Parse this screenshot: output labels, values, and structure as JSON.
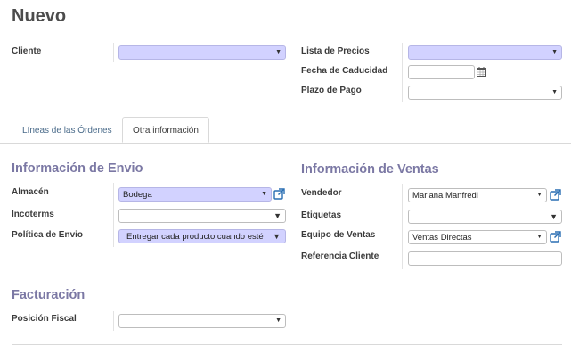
{
  "header": {
    "title": "Nuevo"
  },
  "top_left": {
    "client_label": "Cliente",
    "client_value": ""
  },
  "top_right": {
    "pricelist_label": "Lista de Precios",
    "pricelist_value": "",
    "expiration_label": "Fecha de Caducidad",
    "expiration_value": "",
    "payment_label": "Plazo de Pago",
    "payment_value": ""
  },
  "tabs": [
    {
      "label": "Líneas de las Órdenes",
      "active": false
    },
    {
      "label": "Otra información",
      "active": true
    }
  ],
  "shipping": {
    "title": "Información de Envio",
    "warehouse_label": "Almacén",
    "warehouse_value": "Bodega",
    "incoterms_label": "Incoterms",
    "incoterms_value": "",
    "policy_label": "Política de Envio",
    "policy_value": "Entregar cada producto cuando esté"
  },
  "sales": {
    "title": "Información de Ventas",
    "salesperson_label": "Vendedor",
    "salesperson_value": "Mariana Manfredi",
    "tags_label": "Etiquetas",
    "tags_value": "",
    "team_label": "Equipo de Ventas",
    "team_value": "Ventas Directas",
    "reference_label": "Referencia Cliente",
    "reference_value": ""
  },
  "billing": {
    "title": "Facturación",
    "fiscal_label": "Posición Fiscal",
    "fiscal_value": ""
  },
  "icons": {
    "caret": "▼",
    "calendar": "calendar-icon",
    "external": "external-link-icon"
  },
  "colors": {
    "required_field": "#d2d2ff",
    "section_title": "#7b78a4",
    "external_icon": "#2a6fb3"
  }
}
